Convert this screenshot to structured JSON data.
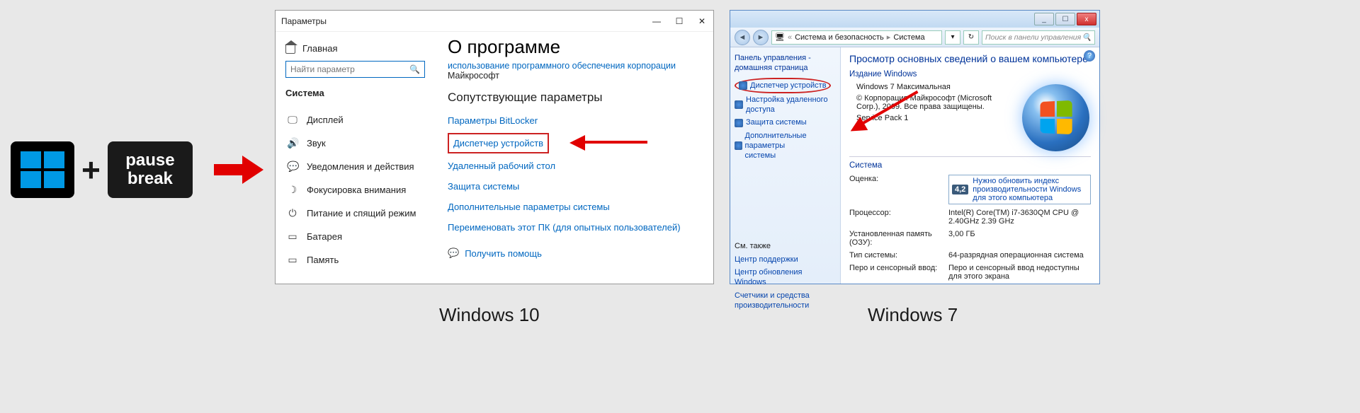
{
  "keycombo": {
    "plus": "+",
    "pause_line1": "pause",
    "pause_line2": "break"
  },
  "captions": {
    "win10": "Windows 10",
    "win7": "Windows 7"
  },
  "win10": {
    "title": "Параметры",
    "controls": {
      "min": "—",
      "max": "☐",
      "close": "✕"
    },
    "home": "Главная",
    "search_placeholder": "Найти параметр",
    "category": "Система",
    "nav": [
      {
        "icon": "🖵",
        "label": "Дисплей"
      },
      {
        "icon": "🔊",
        "label": "Звук"
      },
      {
        "icon": "💬",
        "label": "Уведомления и действия"
      },
      {
        "icon": "☽",
        "label": "Фокусировка внимания"
      },
      {
        "icon": "⏻",
        "label": "Питание и спящий режим"
      },
      {
        "icon": "▭",
        "label": "Батарея"
      },
      {
        "icon": "▭",
        "label": "Память"
      }
    ],
    "main": {
      "heading": "О программе",
      "blurb_line1": "использование программного обеспечения корпорации",
      "blurb_line2": "Майкрософт",
      "related_h": "Сопутствующие параметры",
      "links": {
        "bitlocker": "Параметры BitLocker",
        "devmgr": "Диспетчер устройств",
        "rdp": "Удаленный рабочий стол",
        "security": "Защита системы",
        "advanced": "Дополнительные параметры системы",
        "rename": "Переименовать этот ПК (для опытных пользователей)"
      },
      "help": "Получить помощь"
    }
  },
  "win7": {
    "controls": {
      "min": "_",
      "max": "☐",
      "close": "x"
    },
    "breadcrumb": {
      "p1": "Система и безопасность",
      "p2": "Система"
    },
    "search_placeholder": "Поиск в панели управления",
    "sidebar": {
      "title_l1": "Панель управления -",
      "title_l2": "домашняя страница",
      "devmgr": "Диспетчер устройств",
      "remote_l1": "Настройка удаленного",
      "remote_l2": "доступа",
      "protection": "Защита системы",
      "advanced_l1": "Дополнительные параметры",
      "advanced_l2": "системы",
      "also": "См. также",
      "support": "Центр поддержки",
      "update": "Центр обновления Windows",
      "counters_l1": "Счетчики и средства",
      "counters_l2": "производительности"
    },
    "main": {
      "heading": "Просмотр основных сведений о вашем компьютере",
      "edition_h": "Издание Windows",
      "edition": "Windows 7 Максимальная",
      "copyright": "© Корпорация Майкрософт (Microsoft Corp.), 2009. Все права защищены.",
      "sp": "Service Pack 1",
      "system_h": "Система",
      "rating_label": "Оценка:",
      "rating_value": "4,2",
      "rating_link": "Нужно обновить индекс производительности Windows для этого компьютера",
      "cpu_label": "Процессор:",
      "cpu_value": "Intel(R) Core(TM) i7-3630QM CPU @ 2.40GHz 2.39 GHz",
      "ram_label": "Установленная память (ОЗУ):",
      "ram_value": "3,00 ГБ",
      "type_label": "Тип системы:",
      "type_value": "64-разрядная операционная система",
      "pen_label": "Перо и сенсорный ввод:",
      "pen_value": "Перо и сенсорный ввод недоступны для этого экрана"
    }
  }
}
